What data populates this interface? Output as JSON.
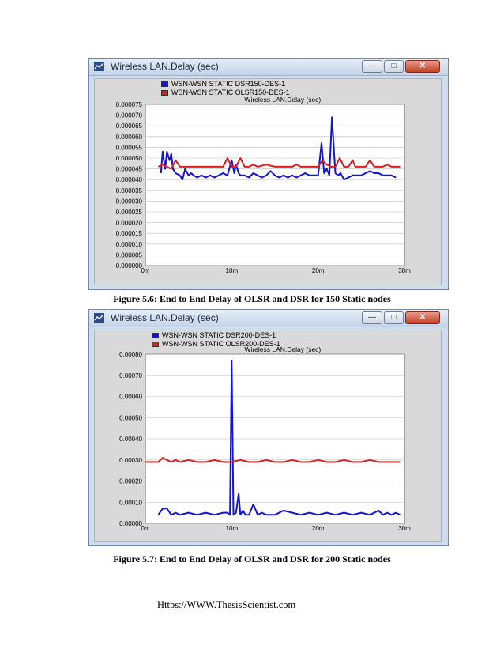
{
  "figures": [
    {
      "window_title": "Wireless LAN.Delay (sec)",
      "caption": "Figure 5.6: End to End Delay of OLSR and DSR for 150 Static nodes"
    },
    {
      "window_title": "Wireless LAN.Delay (sec)",
      "caption": "Figure 5.7: End to End Delay of OLSR and DSR for 200 Static nodes"
    }
  ],
  "window_controls": {
    "minimize": "—",
    "maximize": "□",
    "close": "✕"
  },
  "footer": "Https://WWW.ThesisScientist.com",
  "colors": {
    "dsr": "#1414d4",
    "olsr": "#d81e1e",
    "plot_bg": "#d9d9d9",
    "grid": "#bdbdbd"
  },
  "chart_data": [
    {
      "type": "line",
      "title": "Wireless LAN.Delay (sec)",
      "xlabel": "",
      "ylabel": "",
      "xlim": [
        0,
        30
      ],
      "ylim": [
        0,
        7.5e-05
      ],
      "grid": true,
      "legend": "top-left",
      "x_ticks": [
        0,
        10,
        20,
        30
      ],
      "x_tick_labels": [
        "0m",
        "10m",
        "20m",
        "30m"
      ],
      "y_ticks": [
        0,
        5e-06,
        1e-05,
        1.5e-05,
        2e-05,
        2.5e-05,
        3e-05,
        3.5e-05,
        4e-05,
        4.5e-05,
        5e-05,
        5.5e-05,
        6e-05,
        6.5e-05,
        7e-05,
        7.5e-05
      ],
      "y_tick_labels": [
        "0.000000",
        "0.000005",
        "0.000010",
        "0.000015",
        "0.000020",
        "0.000025",
        "0.000030",
        "0.000035",
        "0.000040",
        "0.000045",
        "0.000050",
        "0.000055",
        "0.000060",
        "0.000065",
        "0.000070",
        "0.000075"
      ],
      "series": [
        {
          "name": "WSN-WSN STATIC DSR150-DES-1",
          "color": "#1414d4",
          "x": [
            1.8,
            2.0,
            2.3,
            2.5,
            2.8,
            3.0,
            3.2,
            3.5,
            4.0,
            4.3,
            4.6,
            5.0,
            5.3,
            5.6,
            6.0,
            6.5,
            7.0,
            7.5,
            8.0,
            8.5,
            9.0,
            9.5,
            10.0,
            10.3,
            10.5,
            10.8,
            11.0,
            11.5,
            12.0,
            12.5,
            13.0,
            13.5,
            14.0,
            14.5,
            15.0,
            15.5,
            16.0,
            16.5,
            17.0,
            17.5,
            18.0,
            18.5,
            19.0,
            19.5,
            20.0,
            20.4,
            20.7,
            21.0,
            21.3,
            21.6,
            22.0,
            22.3,
            22.6,
            23.0,
            23.5,
            24.0,
            24.5,
            25.0,
            25.5,
            26.0,
            26.5,
            27.0,
            27.5,
            28.0,
            28.5,
            29.0
          ],
          "y": [
            4.3e-05,
            5.3e-05,
            4.5e-05,
            5.3e-05,
            4.9e-05,
            5.2e-05,
            4.5e-05,
            4.3e-05,
            4.2e-05,
            4e-05,
            4.5e-05,
            4.2e-05,
            4.3e-05,
            4.2e-05,
            4.1e-05,
            4.2e-05,
            4.1e-05,
            4.2e-05,
            4.1e-05,
            4.2e-05,
            4.3e-05,
            4.2e-05,
            4.9e-05,
            4.3e-05,
            4.7e-05,
            4.3e-05,
            4.2e-05,
            4.2e-05,
            4.1e-05,
            4.3e-05,
            4.2e-05,
            4.1e-05,
            4.2e-05,
            4.4e-05,
            4.2e-05,
            4.1e-05,
            4.2e-05,
            4.1e-05,
            4.2e-05,
            4.1e-05,
            4.2e-05,
            4.3e-05,
            4.2e-05,
            4.2e-05,
            4.2e-05,
            5.7e-05,
            4.3e-05,
            4.5e-05,
            4.2e-05,
            6.9e-05,
            4.3e-05,
            4.2e-05,
            4.3e-05,
            4e-05,
            4.1e-05,
            4.2e-05,
            4.2e-05,
            4.2e-05,
            4.3e-05,
            4.4e-05,
            4.3e-05,
            4.3e-05,
            4.2e-05,
            4.2e-05,
            4.2e-05,
            4.1e-05
          ]
        },
        {
          "name": "WSN-WSN STATIC OLSR150-DES-1",
          "color": "#d81e1e",
          "x": [
            1.5,
            2.0,
            2.5,
            3.0,
            3.5,
            4.0,
            4.5,
            5.0,
            6.0,
            7.0,
            8.0,
            9.0,
            9.5,
            10.0,
            10.5,
            11.0,
            11.5,
            12.0,
            12.5,
            13.0,
            14.0,
            15.0,
            16.0,
            17.0,
            17.5,
            18.0,
            18.5,
            19.0,
            20.0,
            20.5,
            21.0,
            21.5,
            22.0,
            22.5,
            23.0,
            23.5,
            24.0,
            24.3,
            24.6,
            25.0,
            25.5,
            26.0,
            26.5,
            27.0,
            27.5,
            28.0,
            28.5,
            29.0,
            29.5
          ],
          "y": [
            4.6e-05,
            4.7e-05,
            4.6e-05,
            4.5e-05,
            4.9e-05,
            4.6e-05,
            4.6e-05,
            4.6e-05,
            4.6e-05,
            4.6e-05,
            4.6e-05,
            4.6e-05,
            5e-05,
            4.6e-05,
            4.6e-05,
            5e-05,
            4.6e-05,
            4.6e-05,
            4.7e-05,
            4.6e-05,
            4.7e-05,
            4.6e-05,
            4.6e-05,
            4.6e-05,
            4.7e-05,
            4.6e-05,
            4.6e-05,
            4.6e-05,
            4.6e-05,
            4.9e-05,
            4.7e-05,
            4.6e-05,
            4.6e-05,
            5e-05,
            4.6e-05,
            4.6e-05,
            4.9e-05,
            4.6e-05,
            4.6e-05,
            4.6e-05,
            4.6e-05,
            4.9e-05,
            4.6e-05,
            4.6e-05,
            4.6e-05,
            4.7e-05,
            4.6e-05,
            4.6e-05,
            4.6e-05
          ]
        }
      ]
    },
    {
      "type": "line",
      "title": "Wireless LAN.Delay (sec)",
      "xlabel": "",
      "ylabel": "",
      "xlim": [
        0,
        30
      ],
      "ylim": [
        0,
        0.0008
      ],
      "grid": true,
      "legend": "top-left",
      "x_ticks": [
        0,
        10,
        20,
        30
      ],
      "x_tick_labels": [
        "0m",
        "10m",
        "20m",
        "30m"
      ],
      "y_ticks": [
        0,
        0.0001,
        0.0002,
        0.0003,
        0.0004,
        0.0005,
        0.0006,
        0.0007,
        0.0008
      ],
      "y_tick_labels": [
        "0.00000",
        "0.00010",
        "0.00020",
        "0.00030",
        "0.00040",
        "0.00050",
        "0.00060",
        "0.00070",
        "0.00080"
      ],
      "series": [
        {
          "name": "WSN-WSN STATIC DSR200-DES-1",
          "color": "#1414d4",
          "x": [
            1.5,
            2.0,
            2.5,
            3.0,
            3.5,
            4.0,
            5.0,
            6.0,
            7.0,
            8.0,
            9.0,
            9.5,
            9.8,
            10.0,
            10.2,
            10.5,
            10.8,
            11.0,
            11.3,
            11.6,
            12.0,
            12.5,
            13.0,
            13.5,
            14.0,
            15.0,
            16.0,
            17.0,
            18.0,
            19.0,
            20.0,
            21.0,
            22.0,
            23.0,
            24.0,
            25.0,
            26.0,
            27.0,
            27.5,
            28.0,
            28.5,
            29.0,
            29.5
          ],
          "y": [
            4e-05,
            7e-05,
            7e-05,
            4e-05,
            5e-05,
            4e-05,
            5e-05,
            4e-05,
            5e-05,
            4e-05,
            5e-05,
            5e-05,
            4e-05,
            0.00077,
            4e-05,
            5e-05,
            0.00014,
            4e-05,
            6e-05,
            4e-05,
            4e-05,
            9e-05,
            4e-05,
            5e-05,
            4e-05,
            4e-05,
            6e-05,
            5e-05,
            4e-05,
            5e-05,
            4e-05,
            5e-05,
            4e-05,
            5e-05,
            4e-05,
            5e-05,
            4e-05,
            6e-05,
            4e-05,
            5e-05,
            4e-05,
            5e-05,
            4e-05
          ]
        },
        {
          "name": "WSN-WSN STATIC OLSR200-DES-1",
          "color": "#d81e1e",
          "x": [
            0,
            1.5,
            2.0,
            2.5,
            3.0,
            3.5,
            4.0,
            5.0,
            6.0,
            7.0,
            8.0,
            9.0,
            10.0,
            11.0,
            12.0,
            13.0,
            14.0,
            15.0,
            16.0,
            17.0,
            18.0,
            19.0,
            20.0,
            21.0,
            22.0,
            23.0,
            24.0,
            25.0,
            26.0,
            27.0,
            28.0,
            29.0,
            29.5
          ],
          "y": [
            0.00029,
            0.00029,
            0.00031,
            0.0003,
            0.00029,
            0.0003,
            0.00029,
            0.0003,
            0.00029,
            0.00029,
            0.0003,
            0.00029,
            0.00029,
            0.0003,
            0.00029,
            0.00029,
            0.0003,
            0.00029,
            0.00029,
            0.0003,
            0.00029,
            0.00029,
            0.0003,
            0.00029,
            0.00029,
            0.0003,
            0.00029,
            0.00029,
            0.0003,
            0.00029,
            0.00029,
            0.00029,
            0.00029
          ]
        }
      ]
    }
  ]
}
